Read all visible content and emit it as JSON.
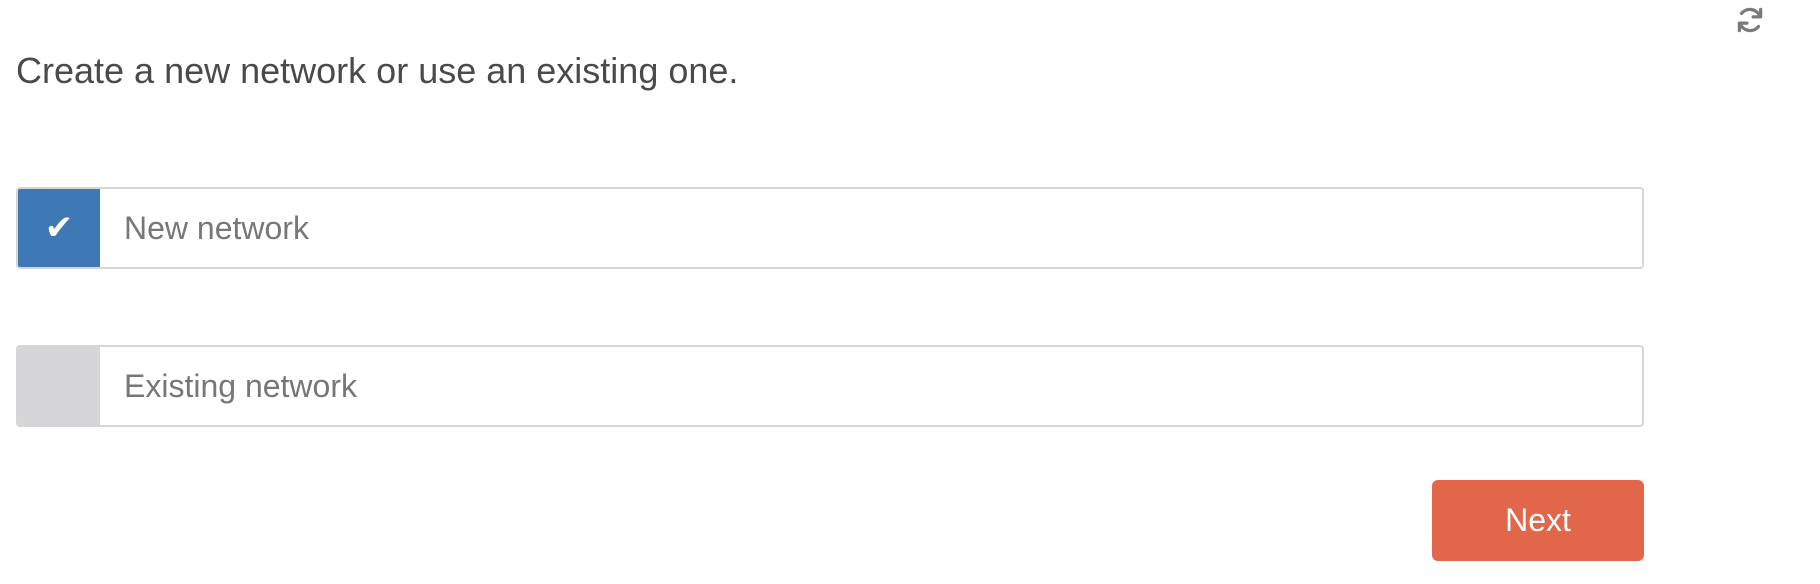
{
  "heading": "Create a new network or use an existing one.",
  "refresh": {
    "icon": "refresh-icon"
  },
  "options": [
    {
      "label": "New network",
      "selected": true,
      "check_icon": "checkmark-icon",
      "check_glyph": "✔"
    },
    {
      "label": "Existing network",
      "selected": false
    }
  ],
  "next_button": {
    "label": "Next"
  },
  "colors": {
    "selected_check_bg": "#3e78b5",
    "unselected_check_bg": "#d6d6d8",
    "next_button_bg": "#e2664a",
    "heading_text": "#4a4a4a",
    "option_text": "#777777",
    "icon_color": "#7a7a7a"
  }
}
